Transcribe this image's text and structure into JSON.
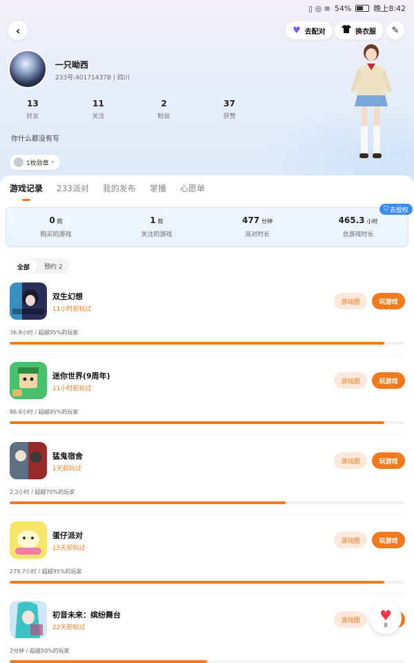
{
  "status_bar": {
    "icons": "▯ ◎ ≋",
    "battery": "54%",
    "time": "晚上8:42"
  },
  "header": {
    "back_icon": "‹",
    "match_button": {
      "icon": "heart-icon",
      "label": "去配对"
    },
    "outfit_button": {
      "icon": "shirt-icon",
      "label": "换衣服"
    },
    "edit_icon": "✎"
  },
  "profile": {
    "nickname": "一只呦西",
    "uid_line": "233号:40171437B | 四川",
    "stats": [
      {
        "value": "13",
        "label": "好友"
      },
      {
        "value": "11",
        "label": "关注"
      },
      {
        "value": "2",
        "label": "粉丝"
      },
      {
        "value": "37",
        "label": "获赞"
      }
    ],
    "bio": "你什么都没有写",
    "medal": "1枚勋章",
    "medal_arrow": "›"
  },
  "tabs": [
    "游戏记录",
    "233派对",
    "我的发布",
    "掌播",
    "心愿单"
  ],
  "active_tab": 0,
  "summary": {
    "auth_label": "去授权",
    "items": [
      {
        "value": "0",
        "unit": "款",
        "label": "购买的游戏"
      },
      {
        "value": "1",
        "unit": "款",
        "label": "关注的游戏"
      },
      {
        "value": "477",
        "unit": "分钟",
        "label": "派对时长"
      },
      {
        "value": "465.3",
        "unit": "小时",
        "label": "总游戏时长"
      }
    ]
  },
  "filters": [
    "全部",
    "预约 2"
  ],
  "game_buttons": {
    "circle": "游戏圈",
    "play": "玩游戏"
  },
  "games": [
    {
      "title": "双生幻想",
      "ago": "11小时前玩过",
      "meta": "36.8小时 / 超越95%的玩家",
      "progress": 95
    },
    {
      "title": "迷你世界(9周年)",
      "ago": "11小时前玩过",
      "meta": "86.6小时 / 超越95%的玩家",
      "progress": 95
    },
    {
      "title": "猛鬼宿舍",
      "ago": "1天前玩过",
      "meta": "2.2小时 / 超越70%的玩家",
      "progress": 70
    },
    {
      "title": "蛋仔派对",
      "ago": "15天前玩过",
      "meta": "279.7小时 / 超越95%的玩家",
      "progress": 95
    },
    {
      "title": "初音未来：缤纷舞台",
      "ago": "22天前玩过",
      "meta": "2分钟 / 超越50%的玩家",
      "progress": 50
    }
  ],
  "like_fab": {
    "icon": "heart-icon",
    "count": "8"
  },
  "colors": {
    "accent": "#f07a1d",
    "accent_light": "#fde9dc",
    "auth_blue": "#3b8ef0",
    "heart": "#e8394a"
  }
}
